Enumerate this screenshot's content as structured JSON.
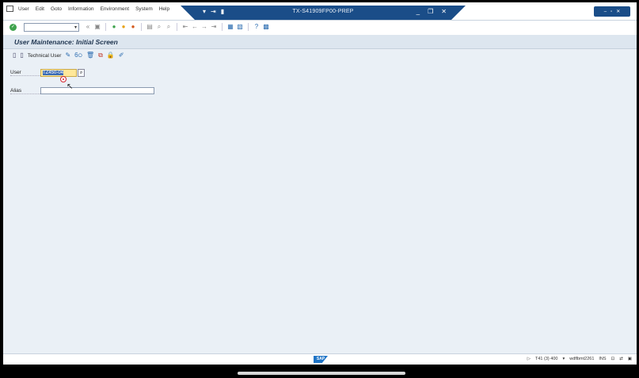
{
  "menubar": {
    "items": [
      "User",
      "Edit",
      "Goto",
      "Information",
      "Environment",
      "System",
      "Help"
    ]
  },
  "window": {
    "title": "TX-S41909FP00-PREP"
  },
  "screen": {
    "title": "User Maintenance: Initial Screen"
  },
  "apptoolbar": {
    "technical_user_label": "Technical User"
  },
  "form": {
    "user_label": "User",
    "user_value": "TZ450-04",
    "alias_label": "Alias",
    "alias_value": ""
  },
  "statusbar": {
    "logo": "SAP",
    "system": "T41 (3) 400",
    "server": "wdflbmt2261",
    "mode": "INS"
  },
  "colors": {
    "title_bar": "#1a4d88",
    "main_bg": "#eaf0f6",
    "required_field": "#ffe89a"
  }
}
